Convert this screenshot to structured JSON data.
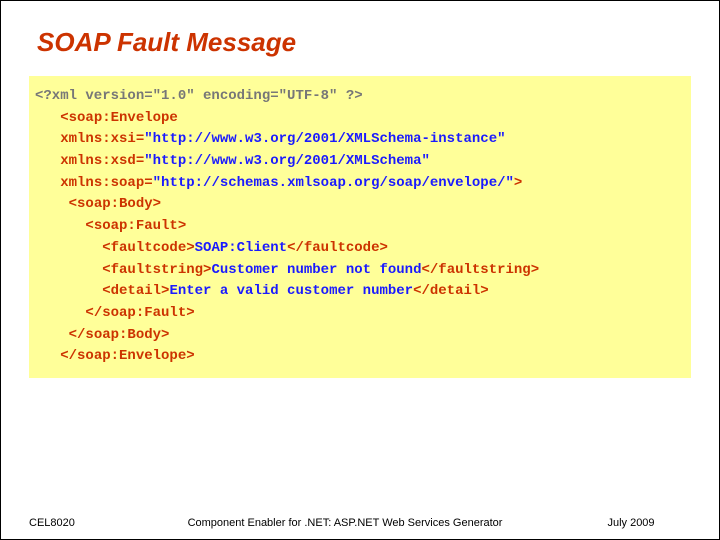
{
  "title": "SOAP Fault Message",
  "code": {
    "l1_pi": "<?xml version=\"1.0\" encoding=\"UTF-8\" ?>",
    "l2_open": "<soap:Envelope",
    "l3_an": "xmlns:xsi=",
    "l3_av": "\"http://www.w3.org/2001/XMLSchema-instance\"",
    "l4_an": "xmlns:xsd=",
    "l4_av": "\"http://www.w3.org/2001/XMLSchema\"",
    "l5_an": "xmlns:soap=",
    "l5_av": "\"http://schemas.xmlsoap.org/soap/envelope/\"",
    "l5_close": ">",
    "l6": "<soap:Body>",
    "l7": "<soap:Fault>",
    "l8_o": "<faultcode>",
    "l8_t": "SOAP:Client",
    "l8_c": "</faultcode>",
    "l9_o": "<faultstring>",
    "l9_t": "Customer number not found",
    "l9_c": "</faultstring>",
    "l10_o": "<detail>",
    "l10_t": "Enter a valid customer number",
    "l10_c": "</detail>",
    "l11": "</soap:Fault>",
    "l12": "</soap:Body>",
    "l13": "</soap:Envelope>"
  },
  "footer": {
    "left": "CEL8020",
    "center": "Component Enabler for .NET: ASP.NET Web Services Generator",
    "right": "July 2009"
  }
}
